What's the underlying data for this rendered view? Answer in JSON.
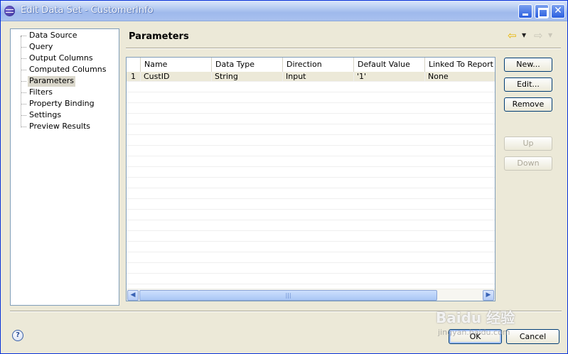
{
  "window": {
    "title": "Edit Data Set - CustomerInfo"
  },
  "tree": {
    "items": [
      {
        "label": "Data Source",
        "selected": false
      },
      {
        "label": "Query",
        "selected": false
      },
      {
        "label": "Output Columns",
        "selected": false
      },
      {
        "label": "Computed Columns",
        "selected": false
      },
      {
        "label": "Parameters",
        "selected": true
      },
      {
        "label": "Filters",
        "selected": false
      },
      {
        "label": "Property Binding",
        "selected": false
      },
      {
        "label": "Settings",
        "selected": false
      },
      {
        "label": "Preview Results",
        "selected": false
      }
    ]
  },
  "panel": {
    "title": "Parameters"
  },
  "table": {
    "columns": [
      "",
      "Name",
      "Data Type",
      "Direction",
      "Default Value",
      "Linked To Report Pa"
    ],
    "rows": [
      [
        "1",
        "CustID",
        "String",
        "Input",
        "'1'",
        "None"
      ]
    ],
    "scroll_grip": "|||"
  },
  "buttons": {
    "new": "New...",
    "edit": "Edit...",
    "remove": "Remove",
    "up": "Up",
    "down": "Down",
    "ok": "OK",
    "cancel": "Cancel"
  },
  "watermark": {
    "main": "Baidu 经验",
    "sub": "jingyan.baidu.com"
  },
  "colors": {
    "accent": "#0831d9",
    "selection": "#dad7cb",
    "dialog_bg": "#ece9d8"
  }
}
